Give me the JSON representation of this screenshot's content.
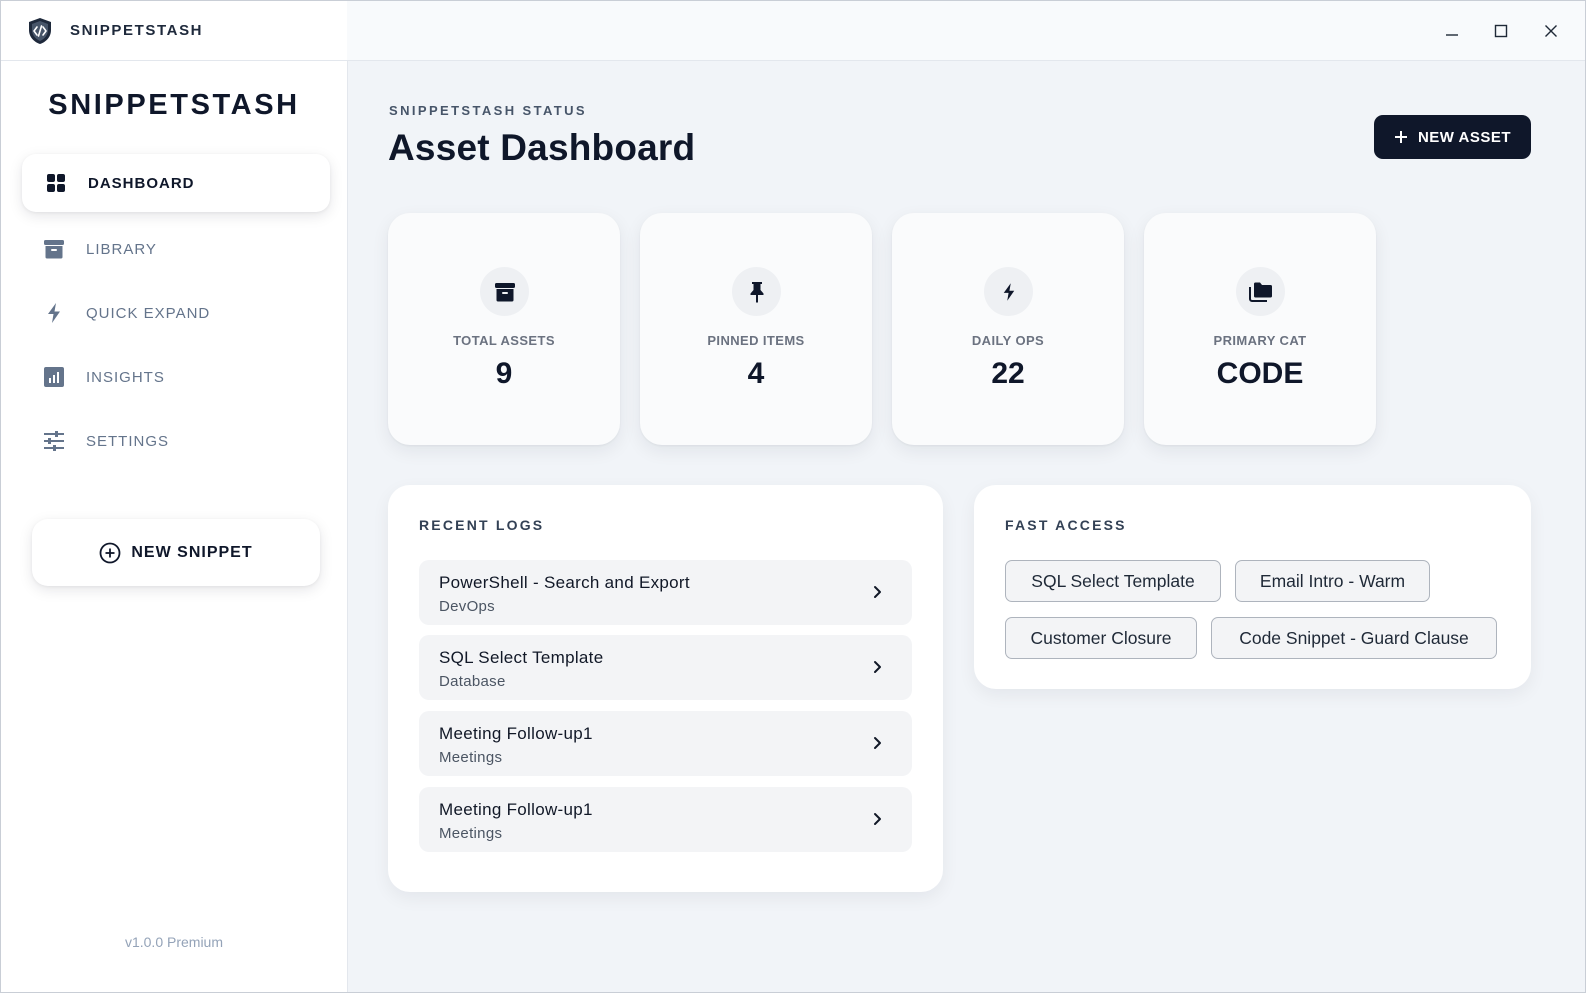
{
  "window": {
    "title": "SNIPPETSTASH",
    "controls": {
      "minimize": "minimize-icon",
      "maximize": "maximize-icon",
      "close": "close-icon"
    }
  },
  "sidebar": {
    "brand": "SNIPPETSTASH",
    "items": [
      {
        "label": "DASHBOARD",
        "icon": "grid-icon",
        "active": true
      },
      {
        "label": "LIBRARY",
        "icon": "archive-icon",
        "active": false
      },
      {
        "label": "QUICK EXPAND",
        "icon": "bolt-icon",
        "active": false
      },
      {
        "label": "INSIGHTS",
        "icon": "chart-icon",
        "active": false
      },
      {
        "label": "SETTINGS",
        "icon": "sliders-icon",
        "active": false
      }
    ],
    "new_snippet_label": "NEW SNIPPET",
    "version": "v1.0.0 Premium"
  },
  "main": {
    "eyebrow": "SNIPPETSTASH STATUS",
    "title": "Asset Dashboard",
    "new_asset_label": "NEW ASSET",
    "stats": [
      {
        "label": "TOTAL ASSETS",
        "value": "9",
        "icon": "archive-icon"
      },
      {
        "label": "PINNED ITEMS",
        "value": "4",
        "icon": "pin-icon"
      },
      {
        "label": "DAILY OPS",
        "value": "22",
        "icon": "bolt-icon"
      },
      {
        "label": "PRIMARY CAT",
        "value": "CODE",
        "icon": "folder-icon"
      }
    ],
    "recent_logs": {
      "title": "RECENT LOGS",
      "items": [
        {
          "title": "PowerShell - Search and Export",
          "category": "DevOps"
        },
        {
          "title": "SQL Select Template",
          "category": "Database"
        },
        {
          "title": "Meeting Follow-up1",
          "category": "Meetings"
        },
        {
          "title": "Meeting Follow-up1",
          "category": "Meetings"
        }
      ]
    },
    "fast_access": {
      "title": "FAST ACCESS",
      "chips": [
        "SQL Select Template",
        "Email Intro - Warm",
        "Customer Closure",
        "Code Snippet - Guard Clause"
      ]
    }
  },
  "colors": {
    "primary_dark": "#0f172a",
    "muted_text": "#64748b",
    "background": "#f1f4f8"
  }
}
